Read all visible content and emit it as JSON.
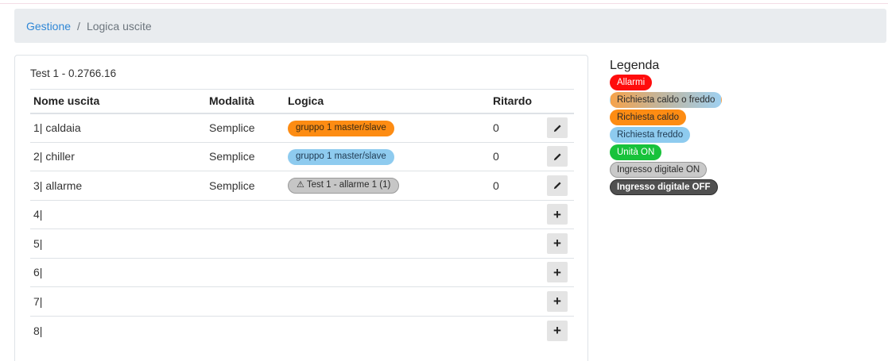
{
  "breadcrumb": {
    "parent": "Gestione",
    "separator": "/",
    "current": "Logica uscite"
  },
  "card": {
    "title": "Test 1 - 0.2766.16"
  },
  "table": {
    "headers": {
      "name": "Nome uscita",
      "mode": "Modalità",
      "logic": "Logica",
      "delay": "Ritardo"
    },
    "rows": [
      {
        "name": "1| caldaia",
        "mode": "Semplice",
        "logic": "gruppo 1 master/slave",
        "logic_color": "orange",
        "delay": "0",
        "action": "edit"
      },
      {
        "name": "2| chiller",
        "mode": "Semplice",
        "logic": "gruppo 1 master/slave",
        "logic_color": "blue",
        "delay": "0",
        "action": "edit"
      },
      {
        "name": "3| allarme",
        "mode": "Semplice",
        "logic": "Test 1 - allarme 1 (1)",
        "logic_color": "grey",
        "logic_icon": "warning-icon",
        "delay": "0",
        "action": "edit"
      },
      {
        "name": "4|",
        "mode": "",
        "logic": "",
        "delay": "",
        "action": "add"
      },
      {
        "name": "5|",
        "mode": "",
        "logic": "",
        "delay": "",
        "action": "add"
      },
      {
        "name": "6|",
        "mode": "",
        "logic": "",
        "delay": "",
        "action": "add"
      },
      {
        "name": "7|",
        "mode": "",
        "logic": "",
        "delay": "",
        "action": "add"
      },
      {
        "name": "8|",
        "mode": "",
        "logic": "",
        "delay": "",
        "action": "add"
      }
    ],
    "add_symbol": "+"
  },
  "legend": {
    "title": "Legenda",
    "items": [
      {
        "label": "Allarmi",
        "color": "#ff0000"
      },
      {
        "label": "Richiesta caldo o freddo",
        "color": "#c2b59c"
      },
      {
        "label": "Richiesta caldo",
        "color": "#fd8c13"
      },
      {
        "label": "Richiesta freddo",
        "color": "#8ecbef"
      },
      {
        "label": "Unità ON",
        "color": "#18c23b"
      },
      {
        "label": "Ingresso digitale ON",
        "color": "#c9c9c9"
      },
      {
        "label": "Ingresso digitale OFF",
        "color": "#505050"
      }
    ]
  }
}
